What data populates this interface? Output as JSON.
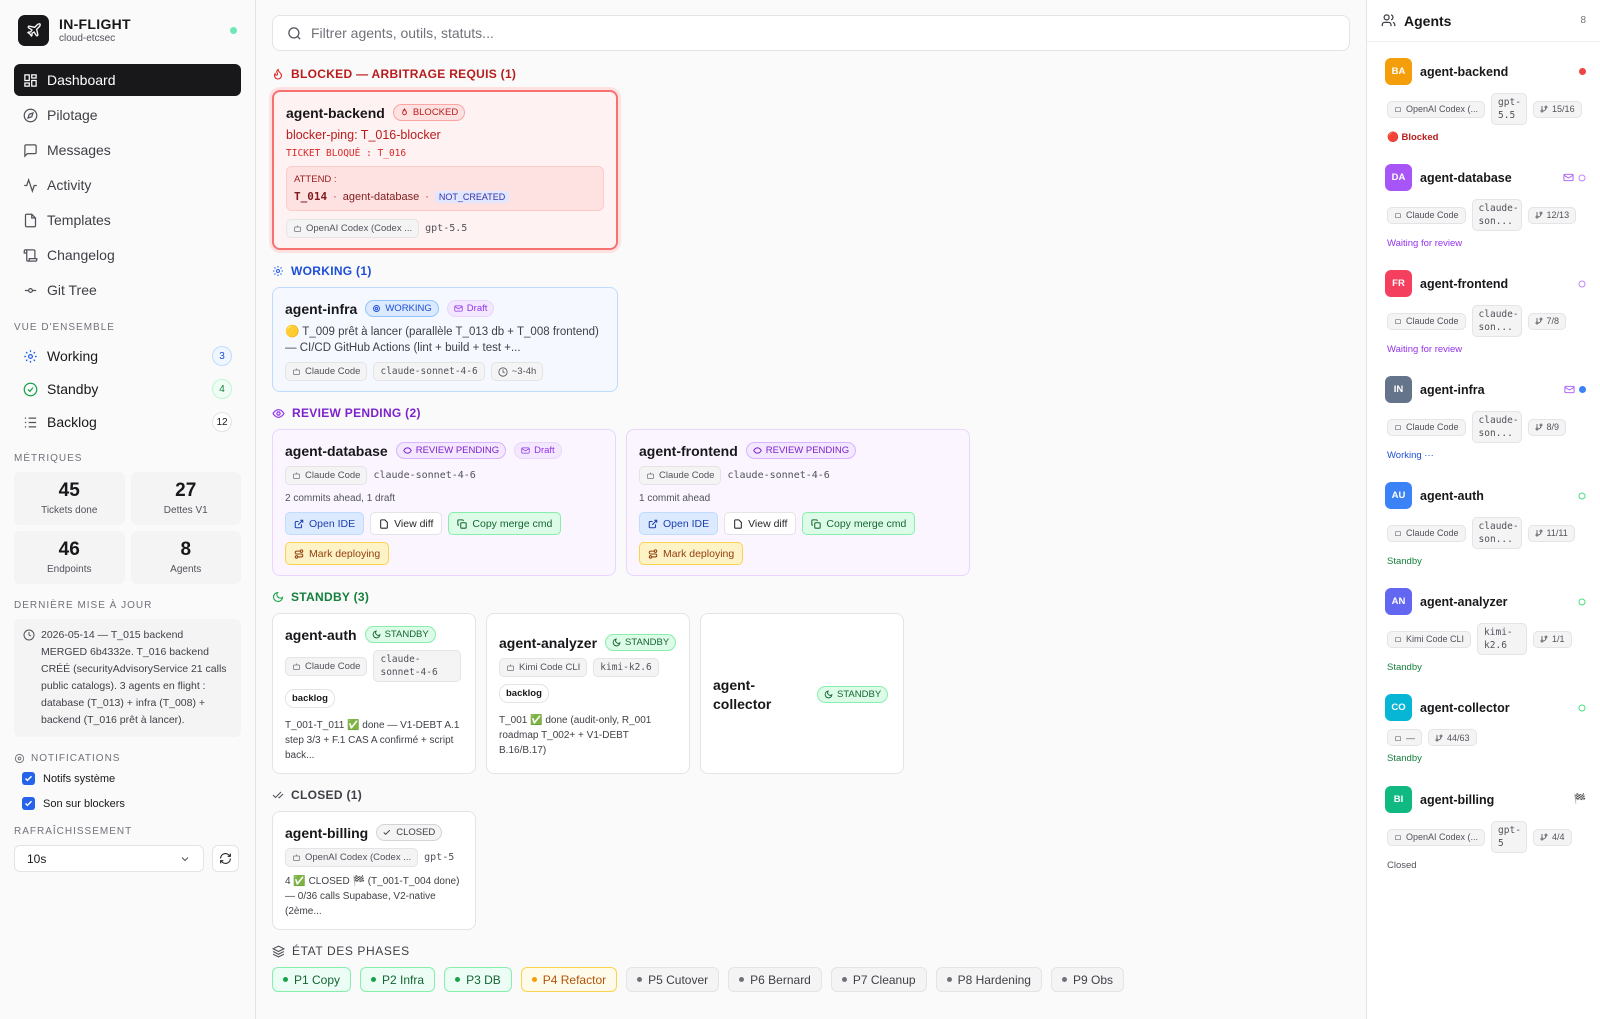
{
  "brand": {
    "title": "IN-FLIGHT",
    "subtitle": "cloud-etcsec"
  },
  "nav": [
    {
      "label": "Dashboard",
      "icon": "dashboard-icon"
    },
    {
      "label": "Pilotage"
    },
    {
      "label": "Messages"
    },
    {
      "label": "Activity"
    },
    {
      "label": "Templates"
    },
    {
      "label": "Changelog"
    },
    {
      "label": "Git Tree"
    }
  ],
  "overview": {
    "title": "VUE D'ENSEMBLE",
    "items": [
      {
        "label": "Working",
        "count": "3"
      },
      {
        "label": "Standby",
        "count": "4"
      },
      {
        "label": "Backlog",
        "count": "12"
      }
    ]
  },
  "metrics": {
    "title": "MÉTRIQUES",
    "items": [
      {
        "value": "45",
        "label": "Tickets done"
      },
      {
        "value": "27",
        "label": "Dettes V1"
      },
      {
        "value": "46",
        "label": "Endpoints"
      },
      {
        "value": "8",
        "label": "Agents"
      }
    ]
  },
  "last_update": {
    "title": "DERNIÈRE MISE À JOUR",
    "text": "2026-05-14 — T_015 backend MERGED 6b4332e. T_016 backend CRÉÉ (securityAdvisoryService 21 calls public catalogs). 3 agents en flight : database (T_013) + infra (T_008) + backend (T_016 prêt à lancer)."
  },
  "notifications": {
    "title": "NOTIFICATIONS",
    "items": [
      "Notifs système",
      "Son sur blockers"
    ]
  },
  "refresh": {
    "title": "RAFRAÎCHISSEMENT",
    "value": "10s"
  },
  "search": {
    "placeholder": "Filtrer agents, outils, statuts..."
  },
  "groups": {
    "blocked": {
      "title": "BLOCKED — ARBITRAGE REQUIS (1)",
      "color": "#b91c1c"
    },
    "working": {
      "title": "WORKING (1)",
      "color": "#1d4ed8"
    },
    "review": {
      "title": "REVIEW PENDING (2)",
      "color": "#7e22ce"
    },
    "standby": {
      "title": "STANDBY (3)",
      "color": "#15803d"
    },
    "closed": {
      "title": "CLOSED (1)",
      "color": "#3f3f46"
    },
    "phases": {
      "title": "ÉTAT DES PHASES",
      "color": "#3f3f46"
    }
  },
  "cards": {
    "backend": {
      "name": "agent-backend",
      "badge": "BLOCKED",
      "ping": "blocker-ping: T_016-blocker",
      "ticket": "TICKET BLOQUÉ : T_016",
      "waits_label": "ATTEND :",
      "wait_ticket": "T_014",
      "wait_agent": "agent-database",
      "wait_status": "NOT_CREATED",
      "tool": "OpenAI Codex (Codex ...",
      "model": "gpt-5.5"
    },
    "infra": {
      "name": "agent-infra",
      "badge": "WORKING",
      "draft": "Draft",
      "desc": "🟡 T_009 prêt à lancer (parallèle T_013 db + T_008 frontend) — CI/CD GitHub Actions (lint + build + test +...",
      "tool": "Claude Code",
      "model": "claude-sonnet-4-6",
      "time": "~3-4h"
    },
    "database": {
      "name": "agent-database",
      "badge": "REVIEW PENDING",
      "draft": "Draft",
      "tool": "Claude Code",
      "model": "claude-sonnet-4-6",
      "ahead": "2 commits ahead, 1 draft",
      "btn_ide": "Open IDE",
      "btn_diff": "View diff",
      "btn_merge": "Copy merge cmd",
      "btn_deploy": "Mark deploying"
    },
    "frontend": {
      "name": "agent-frontend",
      "badge": "REVIEW PENDING",
      "tool": "Claude Code",
      "model": "claude-sonnet-4-6",
      "ahead": "1 commit ahead",
      "btn_ide": "Open IDE",
      "btn_diff": "View diff",
      "btn_merge": "Copy merge cmd",
      "btn_deploy": "Mark deploying"
    },
    "auth": {
      "name": "agent-auth",
      "badge": "STANDBY",
      "tool": "Claude Code",
      "model": "claude-sonnet-4-6",
      "backlog": "backlog",
      "desc": "T_001-T_011 ✅ done — V1-DEBT A.1 step 3/3 + F.1 CAS A confirmé + script back..."
    },
    "analyzer": {
      "name": "agent-analyzer",
      "badge": "STANDBY",
      "tool": "Kimi Code CLI",
      "model": "kimi-k2.6",
      "backlog": "backlog",
      "desc": "T_001 ✅ done (audit-only, R_001 roadmap T_002+ + V1-DEBT B.16/B.17)"
    },
    "collector": {
      "name": "agent-collector",
      "badge": "STANDBY"
    },
    "billing": {
      "name": "agent-billing",
      "badge": "CLOSED",
      "tool": "OpenAI Codex (Codex ...",
      "model": "gpt-5",
      "desc": "4 ✅ CLOSED 🏁 (T_001-T_004 done) — 0/36 calls Supabase, V2-native (2ème..."
    }
  },
  "phases": [
    {
      "label": "P1 Copy",
      "state": "done"
    },
    {
      "label": "P2 Infra",
      "state": "done"
    },
    {
      "label": "P3 DB",
      "state": "done"
    },
    {
      "label": "P4 Refactor",
      "state": "active"
    },
    {
      "label": "P5 Cutover",
      "state": "todo"
    },
    {
      "label": "P6 Bernard",
      "state": "todo"
    },
    {
      "label": "P7 Cleanup",
      "state": "todo"
    },
    {
      "label": "P8 Hardening",
      "state": "todo"
    },
    {
      "label": "P9 Obs",
      "state": "todo"
    }
  ],
  "agents_panel": {
    "title": "Agents",
    "count": "8",
    "agents": [
      {
        "initials": "BA",
        "name": "agent-backend",
        "color": "#f59e0b",
        "tool": "OpenAI Codex (...",
        "model": "gpt-5.5",
        "progress": "15/16",
        "status": "🔴 Blocked",
        "status_color": "#b91c1c"
      },
      {
        "initials": "DA",
        "name": "agent-database",
        "color": "#a855f7",
        "tool": "Claude Code",
        "model": "claude-son...",
        "progress": "12/13",
        "status": "Waiting for review",
        "status_color": "#9333ea"
      },
      {
        "initials": "FR",
        "name": "agent-frontend",
        "color": "#f43f5e",
        "tool": "Claude Code",
        "model": "claude-son...",
        "progress": "7/8",
        "status": "Waiting for review",
        "status_color": "#9333ea"
      },
      {
        "initials": "IN",
        "name": "agent-infra",
        "color": "#64748b",
        "tool": "Claude Code",
        "model": "claude-son...",
        "progress": "8/9",
        "status": "Working ···",
        "status_color": "#1d4ed8"
      },
      {
        "initials": "AU",
        "name": "agent-auth",
        "color": "#3b82f6",
        "tool": "Claude Code",
        "model": "claude-son...",
        "progress": "11/11",
        "status": "Standby",
        "status_color": "#15803d"
      },
      {
        "initials": "AN",
        "name": "agent-analyzer",
        "color": "#6366f1",
        "tool": "Kimi Code CLI",
        "model": "kimi-k2.6",
        "progress": "1/1",
        "status": "Standby",
        "status_color": "#15803d"
      },
      {
        "initials": "CO",
        "name": "agent-collector",
        "color": "#06b6d4",
        "tool": "—",
        "model": "",
        "progress": "44/63",
        "status": "Standby",
        "status_color": "#15803d"
      },
      {
        "initials": "BI",
        "name": "agent-billing",
        "color": "#10b981",
        "tool": "OpenAI Codex (...",
        "model": "gpt-5",
        "progress": "4/4",
        "status": "Closed",
        "status_color": "#52525b"
      }
    ]
  }
}
